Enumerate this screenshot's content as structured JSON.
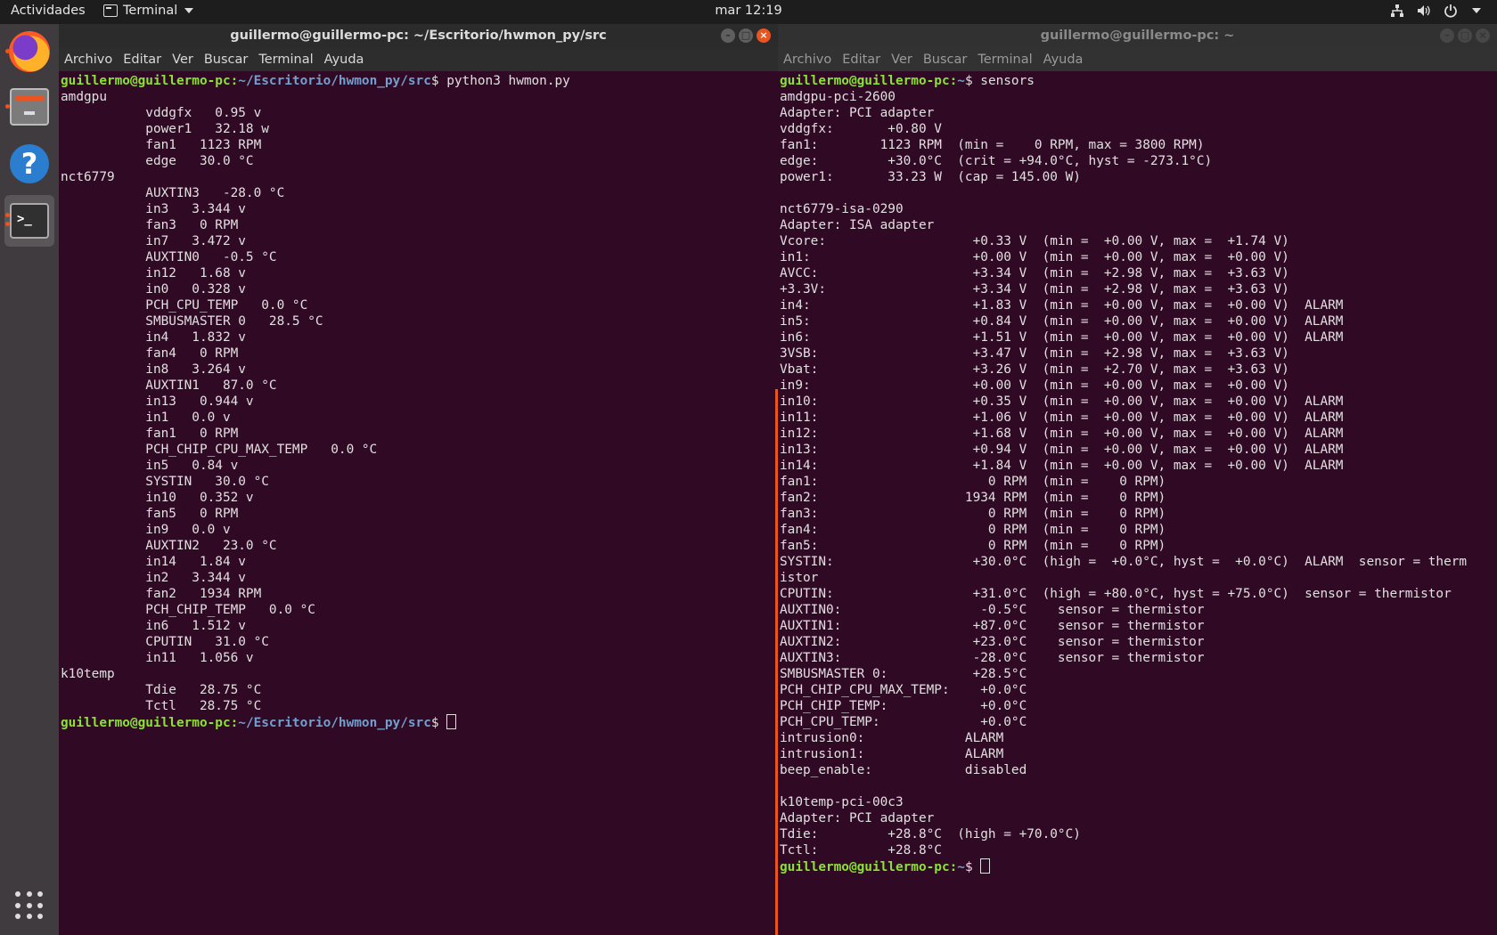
{
  "topbar": {
    "activities": "Actividades",
    "app_menu": "Terminal",
    "clock": "mar 12:19"
  },
  "dock": {
    "items": [
      {
        "name": "Firefox",
        "icon": "firefox-icon"
      },
      {
        "name": "Archivos",
        "icon": "files-icon"
      },
      {
        "name": "Ayuda",
        "icon": "help-icon"
      },
      {
        "name": "Terminal",
        "icon": "terminal-icon"
      }
    ],
    "apps_icon": "show-applications-icon"
  },
  "left_window": {
    "title": "guillermo@guillermo-pc: ~/Escritorio/hwmon_py/src",
    "menu": [
      "Archivo",
      "Editar",
      "Ver",
      "Buscar",
      "Terminal",
      "Ayuda"
    ],
    "prompt_user": "guillermo@guillermo-pc",
    "prompt_path": "~/Escritorio/hwmon_py/src",
    "command": "python3 hwmon.py",
    "output": "amdgpu\n           vddgfx   0.95 v\n           power1   32.18 w\n           fan1   1123 RPM\n           edge   30.0 °C\nnct6779\n           AUXTIN3   -28.0 °C\n           in3   3.344 v\n           fan3   0 RPM\n           in7   3.472 v\n           AUXTIN0   -0.5 °C\n           in12   1.68 v\n           in0   0.328 v\n           PCH_CPU_TEMP   0.0 °C\n           SMBUSMASTER 0   28.5 °C\n           in4   1.832 v\n           fan4   0 RPM\n           in8   3.264 v\n           AUXTIN1   87.0 °C\n           in13   0.944 v\n           in1   0.0 v\n           fan1   0 RPM\n           PCH_CHIP_CPU_MAX_TEMP   0.0 °C\n           in5   0.84 v\n           SYSTIN   30.0 °C\n           in10   0.352 v\n           fan5   0 RPM\n           in9   0.0 v\n           AUXTIN2   23.0 °C\n           in14   1.84 v\n           in2   3.344 v\n           fan2   1934 RPM\n           PCH_CHIP_TEMP   0.0 °C\n           in6   1.512 v\n           CPUTIN   31.0 °C\n           in11   1.056 v\nk10temp\n           Tdie   28.75 °C\n           Tctl   28.75 °C"
  },
  "right_window": {
    "title": "guillermo@guillermo-pc: ~",
    "menu": [
      "Archivo",
      "Editar",
      "Ver",
      "Buscar",
      "Terminal",
      "Ayuda"
    ],
    "prompt_user": "guillermo@guillermo-pc",
    "prompt_path": "~",
    "command": "sensors",
    "output": "amdgpu-pci-2600\nAdapter: PCI adapter\nvddgfx:       +0.80 V\nfan1:        1123 RPM  (min =    0 RPM, max = 3800 RPM)\nedge:         +30.0°C  (crit = +94.0°C, hyst = -273.1°C)\npower1:       33.23 W  (cap = 145.00 W)\n\nnct6779-isa-0290\nAdapter: ISA adapter\nVcore:                   +0.33 V  (min =  +0.00 V, max =  +1.74 V)\nin1:                     +0.00 V  (min =  +0.00 V, max =  +0.00 V)\nAVCC:                    +3.34 V  (min =  +2.98 V, max =  +3.63 V)\n+3.3V:                   +3.34 V  (min =  +2.98 V, max =  +3.63 V)\nin4:                     +1.83 V  (min =  +0.00 V, max =  +0.00 V)  ALARM\nin5:                     +0.84 V  (min =  +0.00 V, max =  +0.00 V)  ALARM\nin6:                     +1.51 V  (min =  +0.00 V, max =  +0.00 V)  ALARM\n3VSB:                    +3.47 V  (min =  +2.98 V, max =  +3.63 V)\nVbat:                    +3.26 V  (min =  +2.70 V, max =  +3.63 V)\nin9:                     +0.00 V  (min =  +0.00 V, max =  +0.00 V)\nin10:                    +0.35 V  (min =  +0.00 V, max =  +0.00 V)  ALARM\nin11:                    +1.06 V  (min =  +0.00 V, max =  +0.00 V)  ALARM\nin12:                    +1.68 V  (min =  +0.00 V, max =  +0.00 V)  ALARM\nin13:                    +0.94 V  (min =  +0.00 V, max =  +0.00 V)  ALARM\nin14:                    +1.84 V  (min =  +0.00 V, max =  +0.00 V)  ALARM\nfan1:                      0 RPM  (min =    0 RPM)\nfan2:                   1934 RPM  (min =    0 RPM)\nfan3:                      0 RPM  (min =    0 RPM)\nfan4:                      0 RPM  (min =    0 RPM)\nfan5:                      0 RPM  (min =    0 RPM)\nSYSTIN:                  +30.0°C  (high =  +0.0°C, hyst =  +0.0°C)  ALARM  sensor = therm\nistor\nCPUTIN:                  +31.0°C  (high = +80.0°C, hyst = +75.0°C)  sensor = thermistor\nAUXTIN0:                  -0.5°C    sensor = thermistor\nAUXTIN1:                 +87.0°C    sensor = thermistor\nAUXTIN2:                 +23.0°C    sensor = thermistor\nAUXTIN3:                 -28.0°C    sensor = thermistor\nSMBUSMASTER 0:           +28.5°C\nPCH_CHIP_CPU_MAX_TEMP:    +0.0°C\nPCH_CHIP_TEMP:            +0.0°C\nPCH_CPU_TEMP:             +0.0°C\nintrusion0:             ALARM\nintrusion1:             ALARM\nbeep_enable:            disabled\n\nk10temp-pci-00c3\nAdapter: PCI adapter\nTdie:         +28.8°C  (high = +70.0°C)\nTctl:         +28.8°C\n"
  },
  "colors": {
    "terminal_bg": "#300a24",
    "prompt_user": "#8ae234",
    "prompt_path": "#729fcf",
    "accent": "#e95420"
  }
}
